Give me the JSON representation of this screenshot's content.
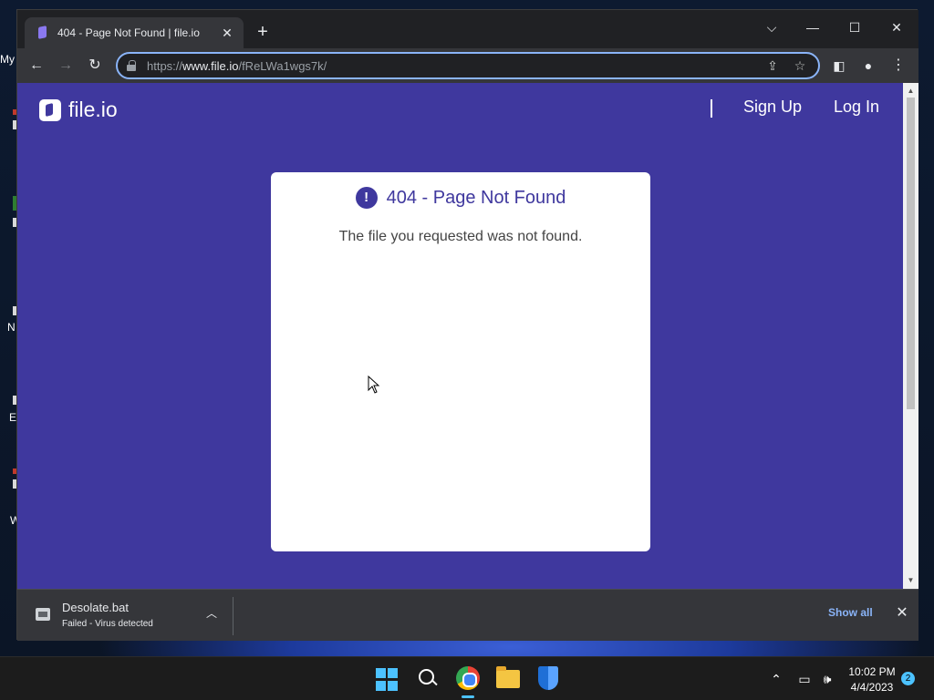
{
  "desktop": {
    "icon_fragments": [
      "My",
      "N",
      "E",
      "W"
    ]
  },
  "browser": {
    "tab": {
      "title": "404 - Page Not Found | file.io"
    },
    "address": {
      "scheme": "https://",
      "host": "www.file.io",
      "path": "/fReLWa1wgs7k/"
    }
  },
  "page": {
    "logo_text": "file.io",
    "nav": {
      "signup": "Sign Up",
      "login": "Log In"
    },
    "error": {
      "icon": "!",
      "title": "404 - Page Not Found",
      "message": "The file you requested was not found."
    }
  },
  "download": {
    "filename": "Desolate.bat",
    "status": "Failed - Virus detected",
    "show_all": "Show all"
  },
  "taskbar": {
    "time": "10:02 PM",
    "date": "4/4/2023",
    "notification_count": "2"
  },
  "colors": {
    "brand": "#3f389e",
    "accent": "#8ab4f8",
    "win_accent": "#4cc2ff"
  }
}
